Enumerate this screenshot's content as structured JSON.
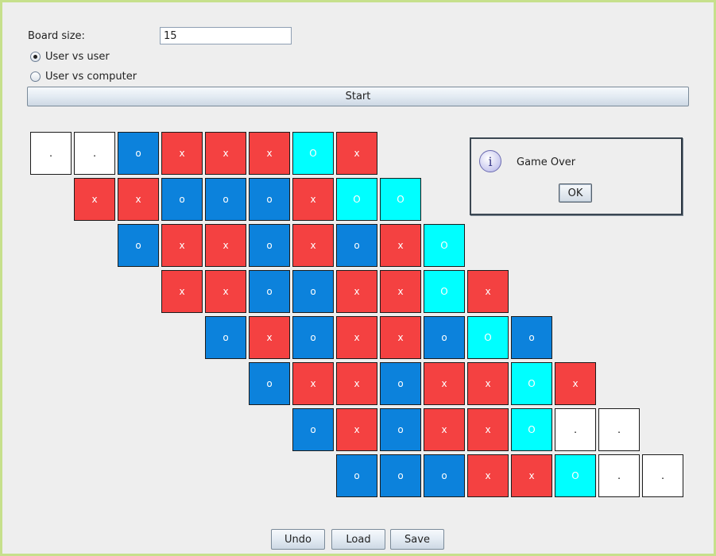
{
  "settings": {
    "board_size_label": "Board size:",
    "board_size_value": "15",
    "modes": [
      {
        "label": "User vs user",
        "selected": true
      },
      {
        "label": "User vs computer",
        "selected": false
      }
    ],
    "start_label": "Start"
  },
  "board": {
    "rows": [
      {
        "offset": 0,
        "cells": [
          ".",
          ".",
          "o",
          "x",
          "x",
          "x",
          "O",
          "x"
        ]
      },
      {
        "offset": 1,
        "cells": [
          "x",
          "x",
          "o",
          "o",
          "o",
          "x",
          "O",
          "O"
        ]
      },
      {
        "offset": 2,
        "cells": [
          "o",
          "x",
          "x",
          "o",
          "x",
          "o",
          "x",
          "O"
        ]
      },
      {
        "offset": 3,
        "cells": [
          "x",
          "x",
          "o",
          "o",
          "x",
          "x",
          "O",
          "x"
        ]
      },
      {
        "offset": 4,
        "cells": [
          "o",
          "x",
          "o",
          "x",
          "x",
          "o",
          "O",
          "o"
        ]
      },
      {
        "offset": 5,
        "cells": [
          "o",
          "x",
          "x",
          "o",
          "x",
          "x",
          "O",
          "x"
        ]
      },
      {
        "offset": 6,
        "cells": [
          "o",
          "x",
          "o",
          "x",
          "x",
          "O",
          ".",
          "."
        ]
      },
      {
        "offset": 7,
        "cells": [
          "o",
          "o",
          "o",
          "x",
          "x",
          "O",
          ".",
          "."
        ]
      }
    ],
    "colors": {
      "empty": "#ffffff",
      "x": "#f44141",
      "o": "#0c82dc",
      "highlight": "#00ffff"
    }
  },
  "dialog": {
    "icon": "info-icon",
    "message": "Game Over",
    "ok_label": "OK"
  },
  "toolbar": {
    "undo_label": "Undo",
    "load_label": "Load",
    "save_label": "Save"
  }
}
